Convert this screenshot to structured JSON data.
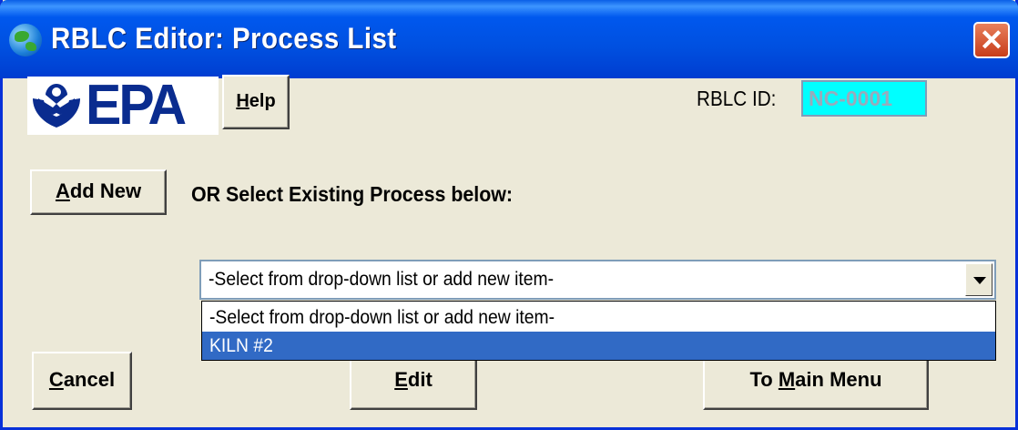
{
  "window": {
    "title": "RBLC Editor:  Process List",
    "close_label": "✕"
  },
  "logo": {
    "text": "EPA"
  },
  "buttons": {
    "help": {
      "prefix": "",
      "accel": "H",
      "rest": "elp"
    },
    "add_new": {
      "prefix": "",
      "accel": "A",
      "rest": "dd New"
    },
    "cancel": {
      "prefix": "",
      "accel": "C",
      "rest": "ancel"
    },
    "edit": {
      "prefix": "",
      "accel": "E",
      "rest": "dit"
    },
    "main_menu": {
      "prefix": "To ",
      "accel": "M",
      "rest": "ain Menu"
    }
  },
  "rblc": {
    "label": "RBLC ID:",
    "value": "NC-0001",
    "field_color": "#00ffff"
  },
  "process": {
    "prompt": "OR Select Existing Process below:",
    "selected": "-Select from drop-down list or add new item-",
    "options": [
      {
        "label": "-Select from drop-down list or add new item-",
        "highlighted": false
      },
      {
        "label": "KILN #2",
        "highlighted": true
      }
    ],
    "highlight_color": "#316ac5"
  }
}
